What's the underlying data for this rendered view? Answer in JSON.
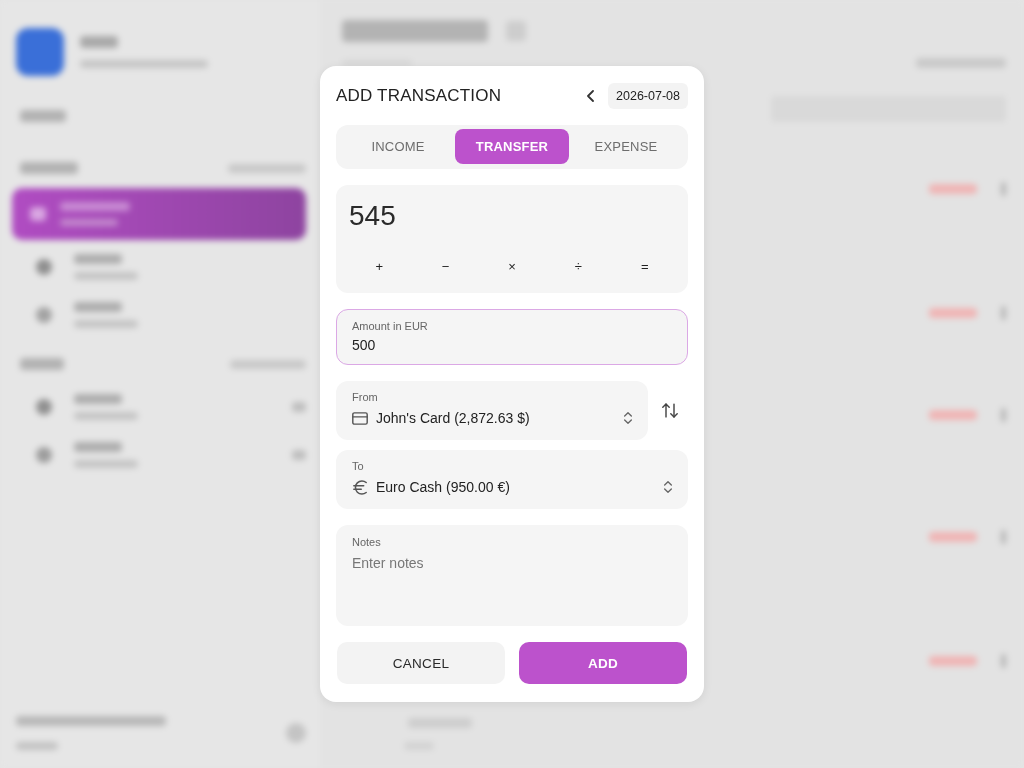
{
  "dialog": {
    "title": "ADD TRANSACTION",
    "date": "2026-07-08",
    "tabs": [
      {
        "label": "INCOME",
        "selected": false
      },
      {
        "label": "TRANSFER",
        "selected": true
      },
      {
        "label": "EXPENSE",
        "selected": false
      }
    ],
    "calculator": {
      "display": "545",
      "operators": [
        "+",
        "−",
        "×",
        "÷",
        "="
      ]
    },
    "amount_field": {
      "label": "Amount in EUR",
      "value": "500",
      "focused": true
    },
    "accounts": [
      {
        "label": "From",
        "value": "John's Card (2,872.63 $)",
        "kind": "card"
      },
      {
        "label": "To",
        "value": "Euro Cash (950.00 €)",
        "kind": "cash"
      }
    ],
    "notes": {
      "label": "Notes",
      "placeholder": "Enter notes"
    },
    "buttons": [
      {
        "label": "CANCEL",
        "kind": "secondary"
      },
      {
        "label": "ADD",
        "kind": "primary"
      }
    ]
  }
}
